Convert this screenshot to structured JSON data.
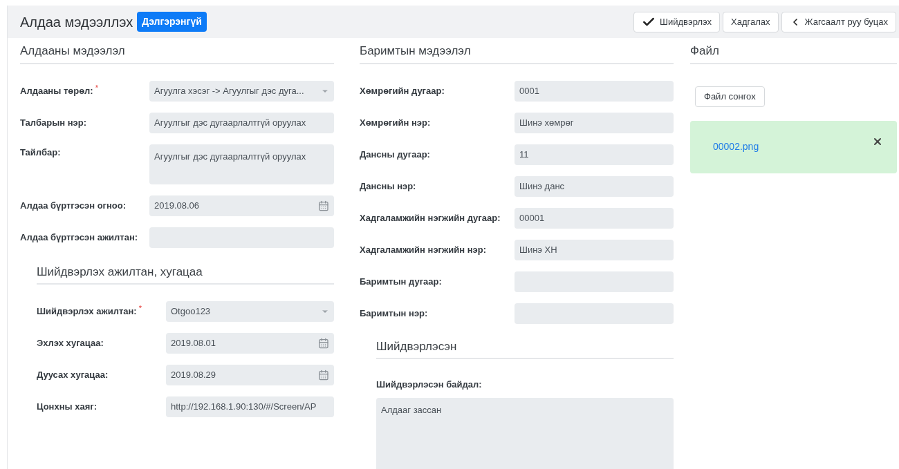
{
  "header": {
    "title": "Алдаа мэдээллэх",
    "badge": "Дэлгэрэнгүй",
    "buttons": [
      {
        "label": "Шийдвэрлэх",
        "kind": "confirm"
      },
      {
        "label": "Хадгалах",
        "kind": "plain"
      },
      {
        "label": "Жагсаалт руу буцах",
        "kind": "back"
      }
    ]
  },
  "error_section": {
    "title": "Алдааны мэдээлэл",
    "fields": [
      {
        "kind": "select",
        "label": "Алдааны төрөл:",
        "required_mark": "*",
        "value": "Агуулга хэсэг -> Агуулгыг дэс дуга..."
      },
      {
        "kind": "text",
        "label": "Талбарын нэр:",
        "value": "Агуулгыг дэс дугаарлалтгүй оруулах"
      },
      {
        "kind": "textarea",
        "label": "Тайлбар:",
        "value": "Агуулгыг дэс дугаарлалтгүй оруулах"
      },
      {
        "kind": "date",
        "label": "Алдаа бүртгэсэн огноо:",
        "value": "2019.08.06"
      },
      {
        "kind": "text",
        "label": "Алдаа бүртгэсэн ажилтан:"
      }
    ]
  },
  "assignee_section": {
    "title": "Шийдвэрлэх ажилтан, хугацаа",
    "fields": [
      {
        "kind": "select",
        "label": "Шийдвэрлэх ажилтан:",
        "required_mark": "*",
        "value": "Otgoo123"
      },
      {
        "kind": "date",
        "label": "Эхлэх хугацаа:",
        "value": "2019.08.01"
      },
      {
        "kind": "date",
        "label": "Дуусах хугацаа:",
        "value": "2019.08.29"
      },
      {
        "kind": "text",
        "label": "Цонхны хаяг:",
        "value": "http://192.168.1.90:130/#/Screen/AP"
      }
    ]
  },
  "document_section": {
    "title": "Баримтын мэдээлэл",
    "fields": [
      {
        "kind": "text",
        "label": "Хөмрөгийн дугаар:",
        "value": "0001"
      },
      {
        "kind": "text",
        "label": "Хөмрөгийн нэр:",
        "value": "Шинэ хөмрөг"
      },
      {
        "kind": "text",
        "label": "Дансны дугаар:",
        "value": "11"
      },
      {
        "kind": "text",
        "label": "Дансны нэр:",
        "value": "Шинэ данс"
      },
      {
        "kind": "text",
        "label": "Хадгаламжийн нэгжийн дугаар:",
        "value": "00001"
      },
      {
        "kind": "text",
        "label": "Хадгаламжийн нэгжийн нэр:",
        "value": "Шинэ ХН"
      },
      {
        "kind": "text",
        "label": "Баримтын дугаар:"
      },
      {
        "kind": "text",
        "label": "Баримтын нэр:"
      }
    ]
  },
  "resolved_section": {
    "title": "Шийдвэрлэсэн",
    "label": "Шийдвэрлэсэн байдал:",
    "value": "Алдааг зассан"
  },
  "file_section": {
    "title": "Файл",
    "choose_button": "Файл сонгох",
    "files": [
      {
        "name": "00002.png"
      }
    ]
  }
}
